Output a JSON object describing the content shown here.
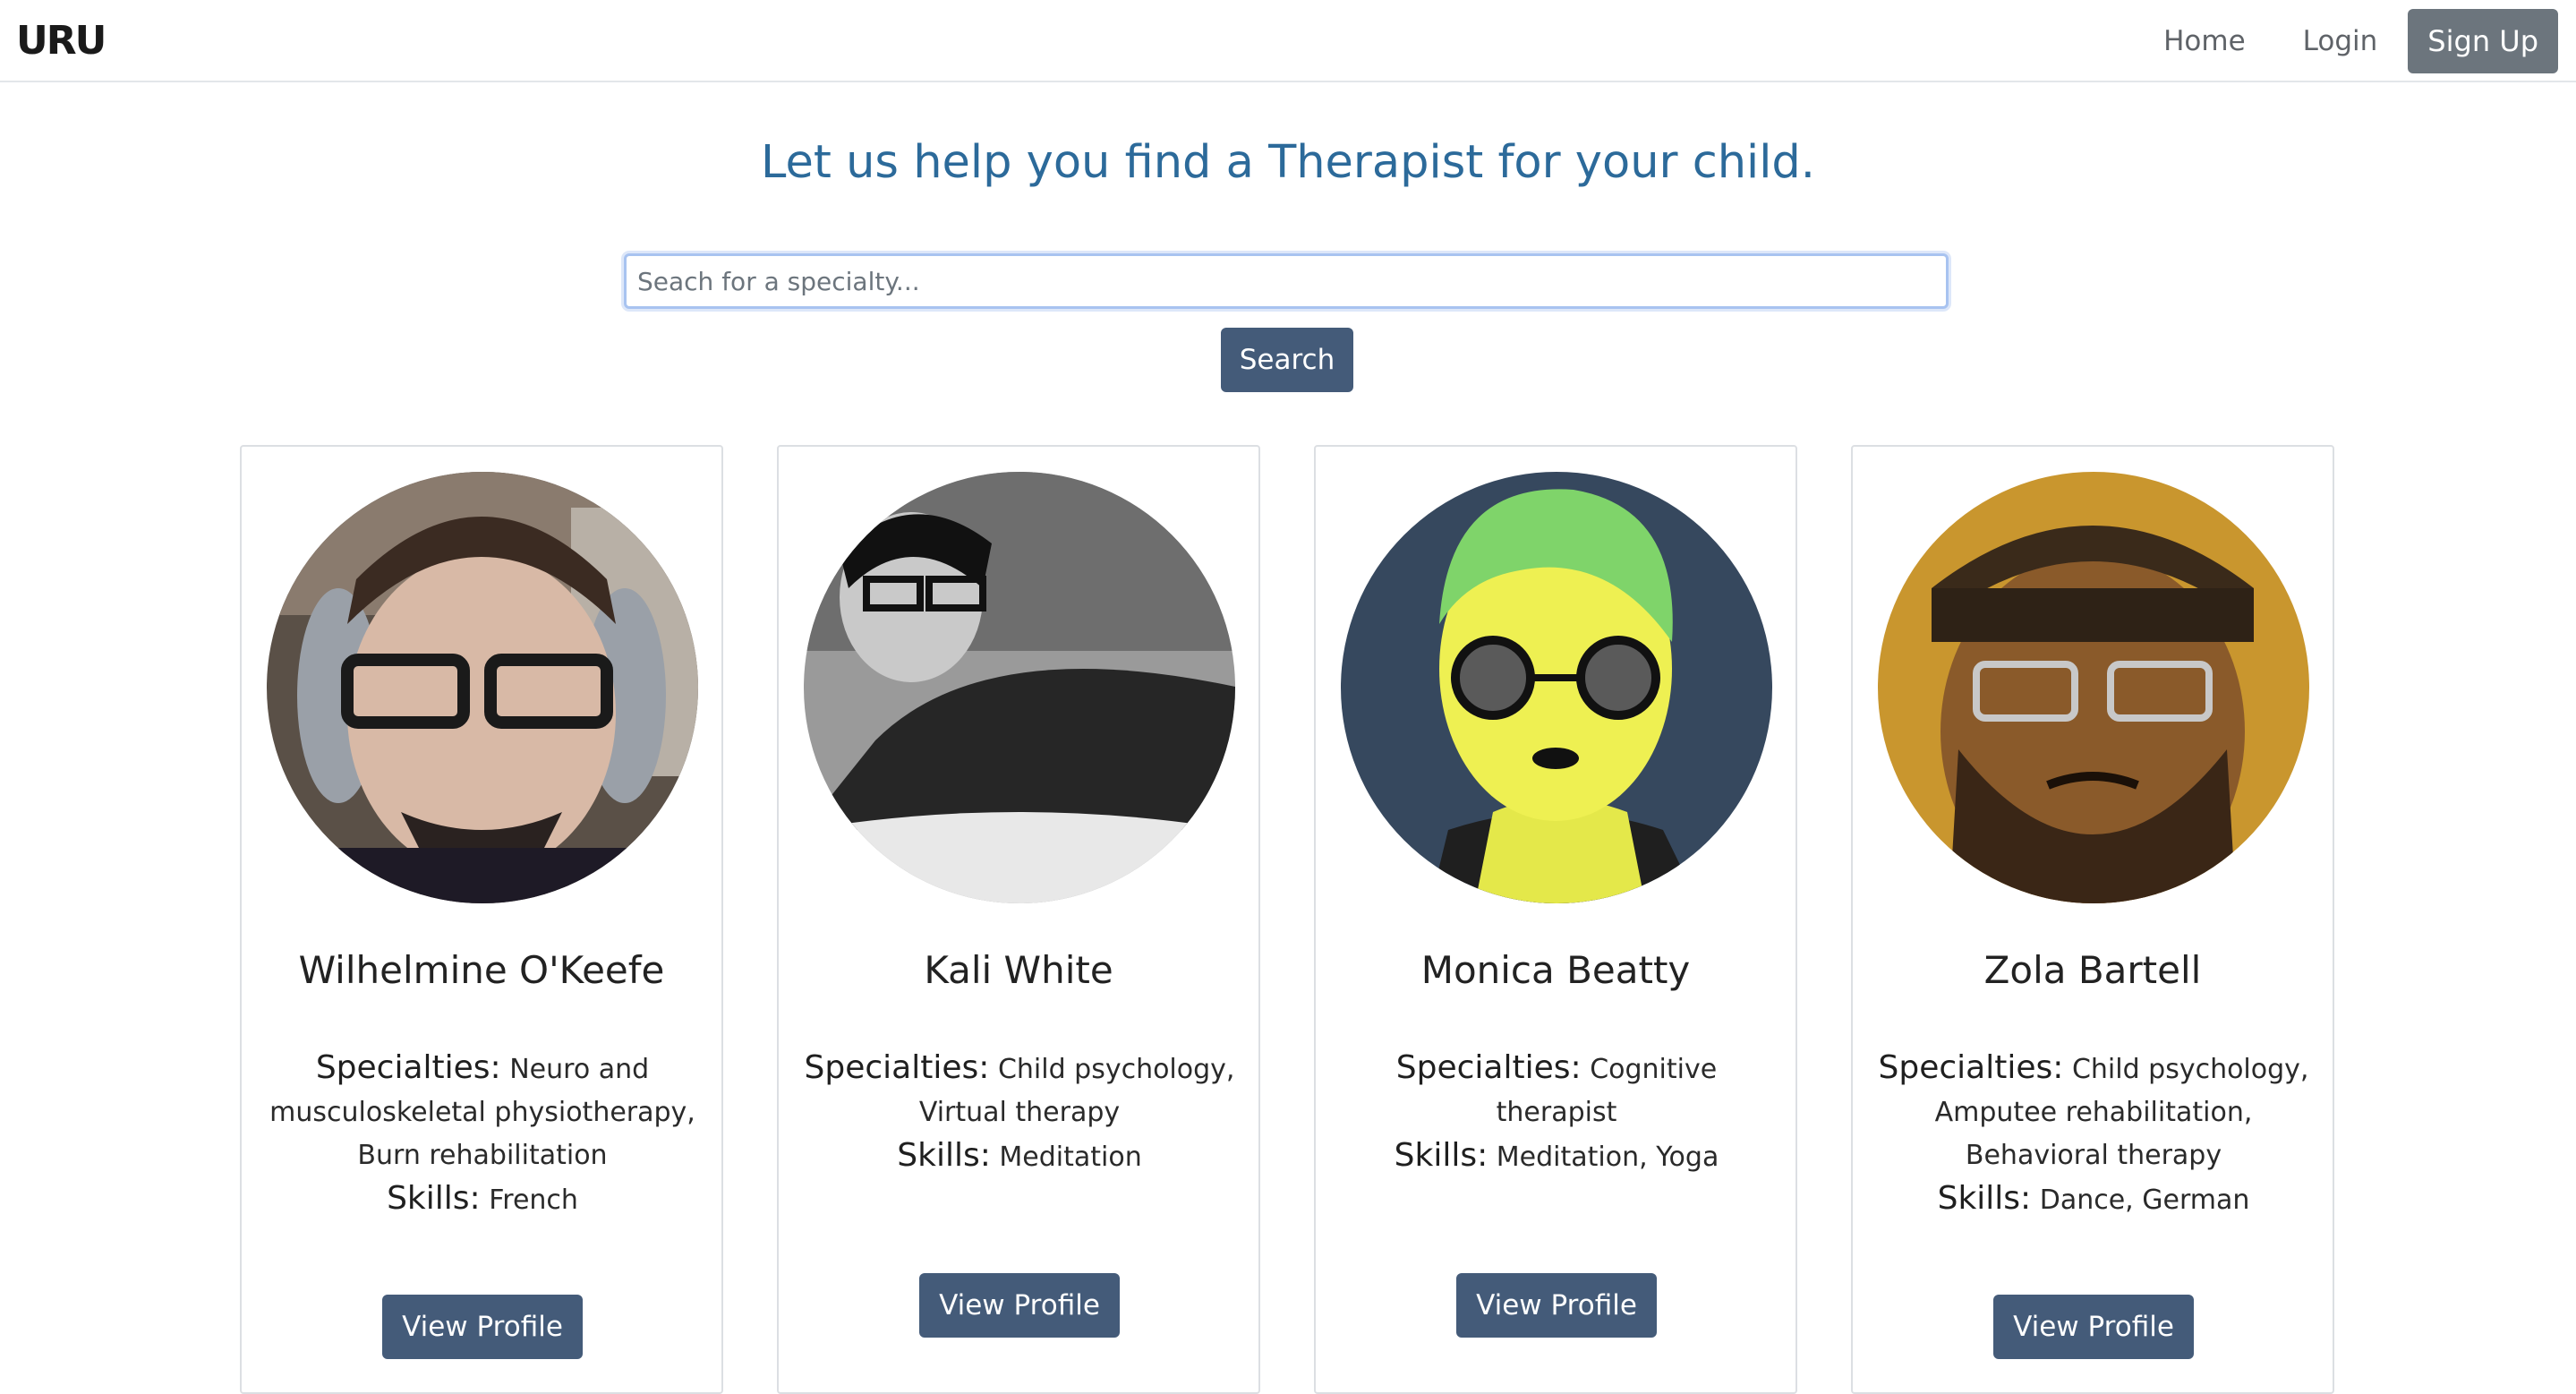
{
  "brand": {
    "logo_text": "URU"
  },
  "nav": {
    "home": "Home",
    "login": "Login",
    "signup": "Sign Up"
  },
  "hero": {
    "title": "Let us help you find a Therapist for your child."
  },
  "search": {
    "placeholder": "Seach for a specialty...",
    "button": "Search"
  },
  "labels": {
    "specialties": "Specialties:",
    "skills": "Skills:",
    "view_profile": "View Profile"
  },
  "therapists": [
    {
      "name": "Wilhelmine O'Keefe",
      "specialties": "Neuro and musculoskeletal physiotherapy, Burn rehabilitation",
      "skills": "French"
    },
    {
      "name": "Kali White",
      "specialties": "Child psychology, Virtual therapy",
      "skills": "Meditation"
    },
    {
      "name": "Monica Beatty",
      "specialties": "Cognitive therapist",
      "skills": "Meditation, Yoga"
    },
    {
      "name": "Zola Bartell",
      "specialties": "Child psychology, Amputee rehabilitation, Behavioral therapy",
      "skills": "Dance, German"
    }
  ],
  "colors": {
    "primary": "#445b79",
    "title": "#2c6a9a",
    "signup": "#6c757d"
  }
}
